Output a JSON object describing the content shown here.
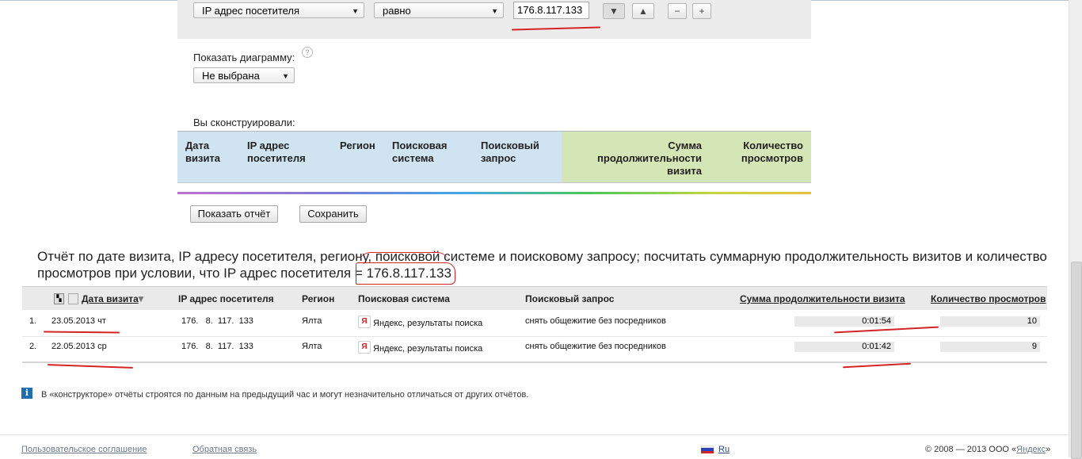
{
  "filter": {
    "field_select": "IP адрес посетителя",
    "operator_select": "равно",
    "value_input": "176.8.117.133",
    "down_label": "▼",
    "up_label": "▲",
    "minus_label": "−",
    "plus_label": "+"
  },
  "chart": {
    "label": "Показать диаграмму:",
    "help": "?",
    "select_value": "Не выбрана"
  },
  "constructed": {
    "label": "Вы сконструировали:",
    "columns": [
      "Дата визита",
      "IP адрес посетителя",
      "Регион",
      "Поисковая система",
      "Поисковый запрос"
    ],
    "metrics": [
      "Сумма продолжительности визита",
      "Количество просмотров"
    ]
  },
  "actions": {
    "show_report": "Показать отчёт",
    "save": "Сохранить"
  },
  "report": {
    "title_main": "Отчёт по дате визита, IP адресу посетителя, региону, поисковой системе и поисковому запросу; посчитать суммарную продолжительность визитов и количество просмотров при условии, что IP адрес посетителя = ",
    "title_ip": "176.8.117.133",
    "headers": {
      "date": "Дата визита",
      "sort_arrow": "▼",
      "ip": "IP адрес посетителя",
      "region": "Регион",
      "search_engine": "Поисковая система",
      "query": "Поисковый запрос",
      "duration": "Сумма продолжительности визита",
      "views": "Количество просмотров"
    },
    "rows": [
      {
        "num": "1.",
        "date": "23.05.2013 чт",
        "ip": "176.   8.  117.  133",
        "region": "Ялта",
        "engine": "Яндекс, результаты поиска",
        "engine_icon": "Я",
        "query": "снять общежитие без посредников",
        "duration": "0:01:54",
        "views": "10",
        "views_fill": 1.0
      },
      {
        "num": "2.",
        "date": "22.05.2013 ср",
        "ip": "176.   8.  117.  133",
        "region": "Ялта",
        "engine": "Яндекс, результаты поиска",
        "engine_icon": "Я",
        "query": "снять общежитие без посредников",
        "duration": "0:01:42",
        "views": "9",
        "views_fill": 0.9
      }
    ]
  },
  "note": {
    "icon": "i",
    "text": "В «конструкторе» отчёты строятся по данным на предыдущий час и могут незначительно отличаться от других отчётов."
  },
  "footer": {
    "agreement": "Пользовательское соглашение",
    "feedback": "Обратная связь",
    "lang": "Ru",
    "copyright_prefix": "© 2008 — 2013 ООО «",
    "copyright_link": "Яндекс",
    "copyright_suffix": "»"
  },
  "colors": {
    "dimension_header_bg": "#cfe3f0",
    "metric_header_bg": "#d5e6b6",
    "annotation_red": "#d42424",
    "yandex_red": "#d62020"
  }
}
